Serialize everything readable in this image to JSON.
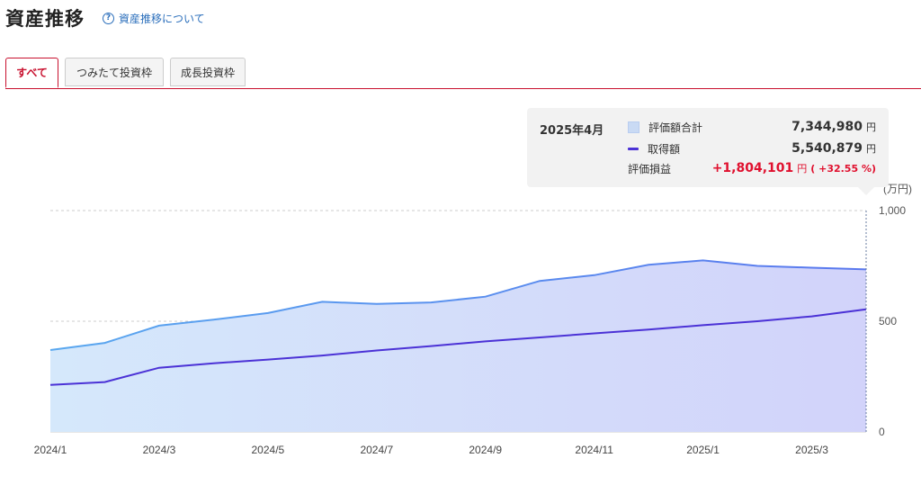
{
  "header": {
    "title": "資産推移",
    "help_icon_text": "?",
    "about_link": "資産推移について"
  },
  "tabs": [
    {
      "label": "すべて",
      "active": true
    },
    {
      "label": "つみたて投資枠",
      "active": false
    },
    {
      "label": "成長投資枠",
      "active": false
    }
  ],
  "tooltip": {
    "month": "2025年4月",
    "rows": [
      {
        "label": "評価額合計",
        "value": "7,344,980",
        "unit": "円"
      },
      {
        "label": "取得額",
        "value": "5,540,879",
        "unit": "円"
      },
      {
        "label": "評価損益",
        "value": "+1,804,101",
        "unit": "円",
        "pct": "( +32.55 %)"
      }
    ]
  },
  "chart_data": {
    "type": "area",
    "unit_label": "(万円)",
    "x": [
      "2024/1",
      "2024/2",
      "2024/3",
      "2024/4",
      "2024/5",
      "2024/6",
      "2024/7",
      "2024/8",
      "2024/9",
      "2024/10",
      "2024/11",
      "2024/12",
      "2025/1",
      "2025/2",
      "2025/3",
      "2025/4"
    ],
    "x_tick_labels": [
      "2024/1",
      "2024/3",
      "2024/5",
      "2024/7",
      "2024/9",
      "2024/11",
      "2025/1",
      "2025/3"
    ],
    "y_ticks": [
      0,
      500,
      1000
    ],
    "ylim": [
      0,
      1000
    ],
    "series": [
      {
        "name": "評価額合計",
        "type": "area",
        "values": [
          370,
          402,
          480,
          507,
          537,
          588,
          578,
          585,
          611,
          682,
          708,
          755,
          775,
          750,
          742,
          734
        ]
      },
      {
        "name": "取得額",
        "type": "line",
        "values": [
          212,
          225,
          290,
          310,
          327,
          345,
          368,
          388,
          409,
          427,
          445,
          462,
          482,
          500,
          522,
          554
        ]
      }
    ],
    "colors": {
      "area_fill_start": "#d5e8fb",
      "area_fill_end": "#d2d3fa",
      "area_line_start": "#5aa8ef",
      "area_line_end": "#5a78ee",
      "cost_line": "#4b32d6",
      "grid": "#cccccc"
    }
  }
}
